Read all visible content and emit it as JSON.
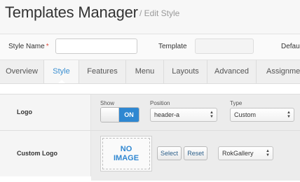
{
  "header": {
    "title": "Templates Manager",
    "subtitle": "/ Edit Style"
  },
  "fields": {
    "style_name_label": "Style Name",
    "required_mark": "*",
    "style_name_value": "",
    "template_label": "Template",
    "template_value": "",
    "default_label": "Default"
  },
  "tabs": [
    {
      "label": "Overview",
      "active": false
    },
    {
      "label": "Style",
      "active": true
    },
    {
      "label": "Features",
      "active": false
    },
    {
      "label": "Menu",
      "active": false
    },
    {
      "label": "Layouts",
      "active": false
    },
    {
      "label": "Advanced",
      "active": false
    },
    {
      "label": "Assignments",
      "active": false
    }
  ],
  "logo_row": {
    "label": "Logo",
    "show_label": "Show",
    "toggle_value": "ON",
    "position_label": "Position",
    "position_value": "header-a",
    "type_label": "Type",
    "type_value": "Custom"
  },
  "custom_logo_row": {
    "label": "Custom Logo",
    "no_image_line1": "NO",
    "no_image_line2": "IMAGE",
    "select_label": "Select",
    "reset_label": "Reset",
    "gallery_value": "RokGallery"
  },
  "colors": {
    "accent": "#2f87d1",
    "active_tab": "#3a8fd1"
  }
}
